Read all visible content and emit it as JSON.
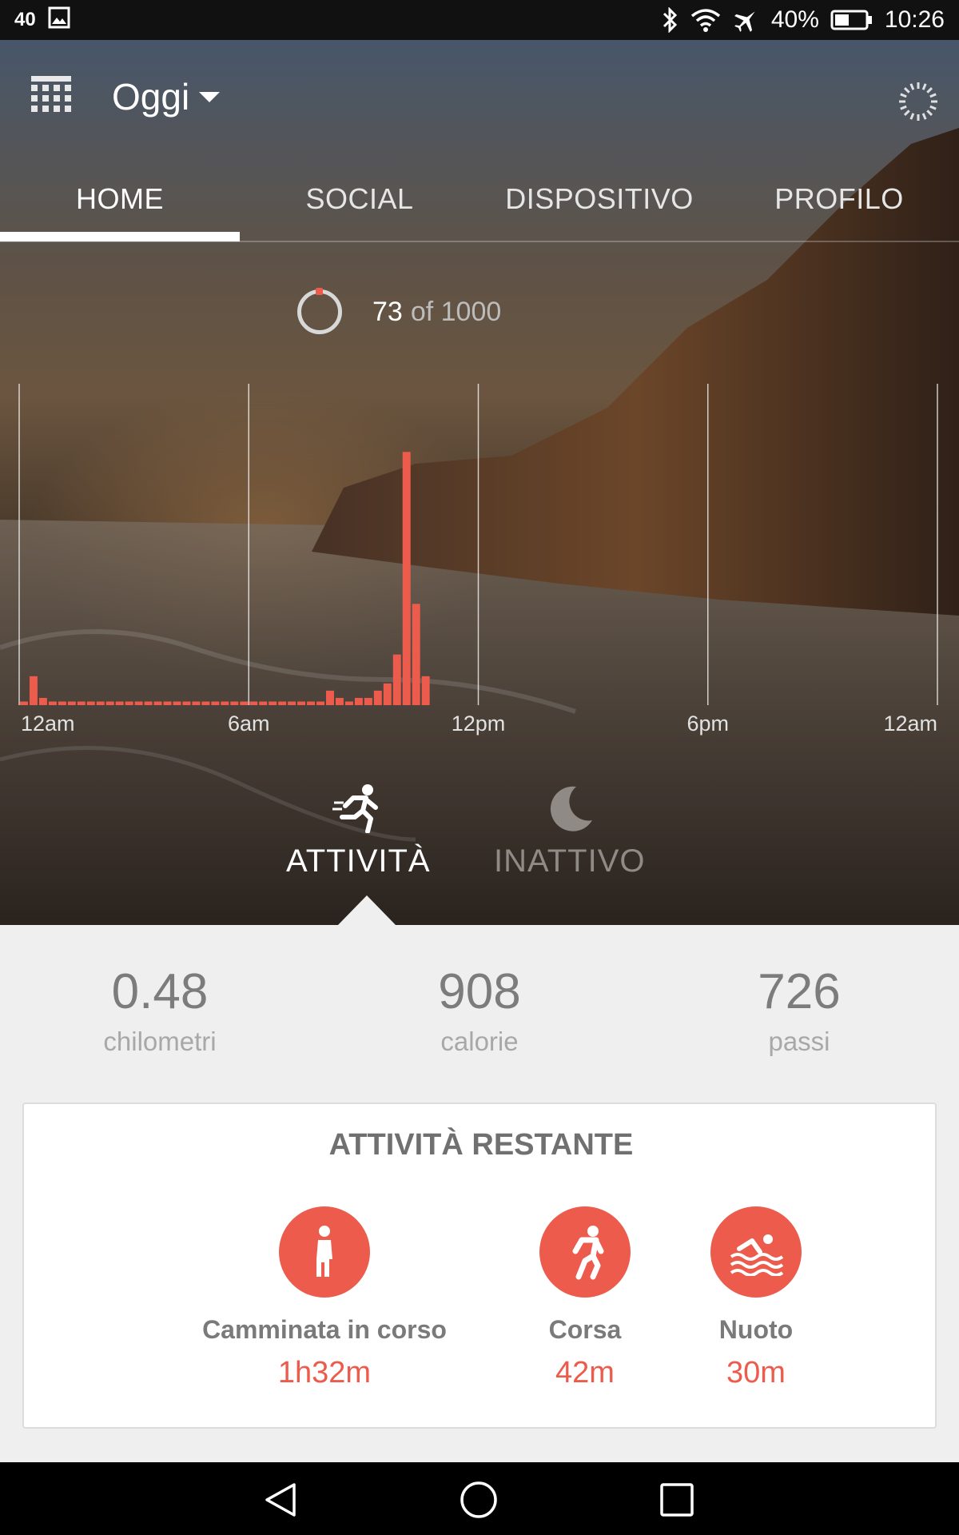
{
  "status_bar": {
    "left_text": "40",
    "battery_text": "40%",
    "time": "10:26",
    "icons": [
      "image-icon",
      "bluetooth-icon",
      "wifi-icon",
      "airplane-icon",
      "battery-icon"
    ]
  },
  "header": {
    "menu_icon": "grid-calendar-icon",
    "date_label": "Oggi",
    "sync_icon": "sync-spinner-icon"
  },
  "tabs": [
    {
      "label": "HOME",
      "active": true
    },
    {
      "label": "SOCIAL",
      "active": false
    },
    {
      "label": "DISPOSITIVO",
      "active": false
    },
    {
      "label": "PROFILO",
      "active": false
    }
  ],
  "goal": {
    "current": "73",
    "of_text": "of 1000"
  },
  "chart_data": {
    "type": "bar",
    "title": "",
    "xlabel": "",
    "ylabel": "",
    "x_tick_labels": [
      "12am",
      "6am",
      "12pm",
      "6pm",
      "12am"
    ],
    "bar_color": "#ec5b4b",
    "values": [
      1,
      8,
      2,
      1,
      1,
      1,
      1,
      1,
      1,
      1,
      1,
      1,
      1,
      1,
      1,
      1,
      1,
      1,
      1,
      1,
      1,
      1,
      1,
      1,
      1,
      1,
      1,
      1,
      1,
      1,
      1,
      1,
      4,
      2,
      1,
      2,
      2,
      4,
      6,
      14,
      70,
      28,
      8
    ],
    "ylim": [
      0,
      80
    ]
  },
  "modes": {
    "activity_label": "ATTIVITÀ",
    "sleep_label": "INATTIVO",
    "active": "activity"
  },
  "stats": [
    {
      "value": "0.48",
      "unit": "chilometri"
    },
    {
      "value": "908",
      "unit": "calorie"
    },
    {
      "value": "726",
      "unit": "passi"
    }
  ],
  "remaining": {
    "title": "ATTIVITÀ RESTANTE",
    "items": [
      {
        "name": "Camminata in corso",
        "time": "1h32m",
        "icon": "walking-icon"
      },
      {
        "name": "Corsa",
        "time": "42m",
        "icon": "running-icon"
      },
      {
        "name": "Nuoto",
        "time": "30m",
        "icon": "swimming-icon"
      }
    ],
    "accent": "#ec5b4b"
  },
  "nav": {
    "icons": [
      "back-icon",
      "home-icon",
      "recents-icon"
    ]
  }
}
